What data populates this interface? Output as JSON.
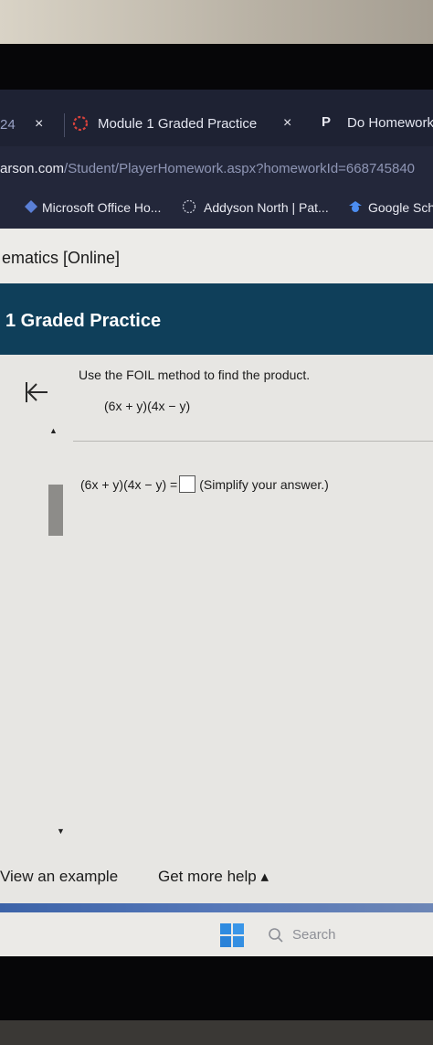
{
  "browser": {
    "tabs": [
      {
        "label": "24",
        "close": "×"
      },
      {
        "label": "Module 1 Graded Practice",
        "close": "×"
      },
      {
        "label": "Do Homework -",
        "icon_text": "P"
      }
    ],
    "url": {
      "domain": "arson.com",
      "path": "/Student/PlayerHomework.aspx?homeworkId=668745840"
    },
    "bookmarks": [
      "Microsoft Office Ho...",
      "Addyson North | Pat...",
      "Google Sch"
    ]
  },
  "page": {
    "course_title": "ematics [Online]",
    "banner_title": "1 Graded Practice"
  },
  "question": {
    "instruction": "Use the FOIL method to find the product.",
    "expression": "(6x + y)(4x − y)",
    "answer_prefix": "(6x + y)(4x − y) =",
    "answer_hint": "(Simplify your answer.)",
    "answer_value": ""
  },
  "footer": {
    "view_example": "View an example",
    "get_help": "Get more help ▴"
  },
  "taskbar": {
    "search_label": "Search"
  },
  "colors": {
    "banner": "#0f3f5a",
    "tabbar": "#1e2233",
    "accent_blue": "#3c63a8"
  }
}
